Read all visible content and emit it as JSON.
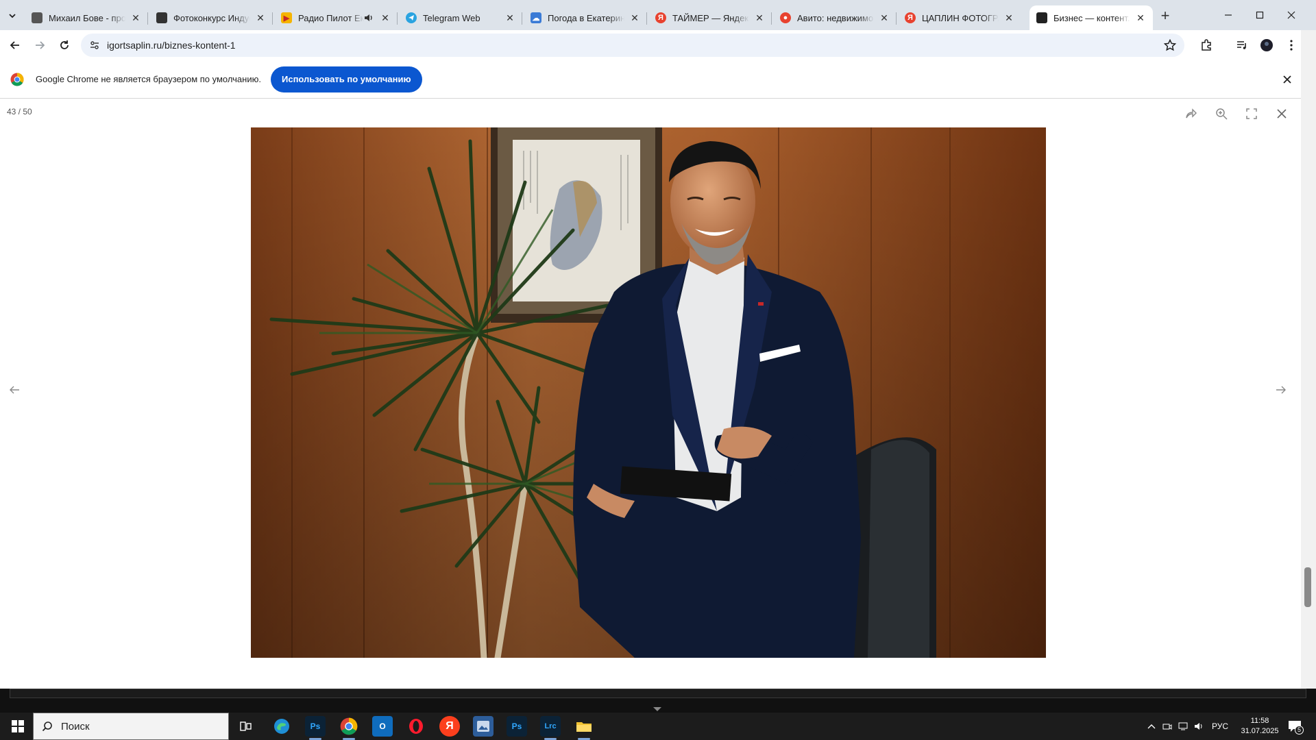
{
  "browser": {
    "tabs": [
      {
        "title": "Михаил Бове - проф",
        "favicon": "mb-icon",
        "color": "#444"
      },
      {
        "title": "Фотоконкурс Индус",
        "favicon": "photo-contest-icon",
        "color": "#333"
      },
      {
        "title": "Радио Пилот Ека",
        "favicon": "play-icon",
        "color": "#f5b400"
      },
      {
        "title": "Telegram Web",
        "favicon": "telegram-icon",
        "color": "#2aa3e0"
      },
      {
        "title": "Погода в Екатеринб",
        "favicon": "weather-icon",
        "color": "#3b7bd6"
      },
      {
        "title": "ТАЙМЕР — Яндекс",
        "favicon": "yandex-icon",
        "color": "#e8422f"
      },
      {
        "title": "Авито: недвижимос",
        "favicon": "avito-icon",
        "color": "#e8422f"
      },
      {
        "title": "ЦАПЛИН ФОТОГРАФ",
        "favicon": "yandex-icon",
        "color": "#e8422f"
      },
      {
        "title": "Бизнес — контент. Ф",
        "favicon": "site-icon",
        "color": "#222"
      }
    ],
    "url": "igortsaplin.ru/biznes-kontent-1"
  },
  "infobar": {
    "message": "Google Chrome не является браузером по умолчанию.",
    "button": "Использовать по умолчанию"
  },
  "lightbox": {
    "counter": "43 / 50"
  },
  "taskbar": {
    "search_placeholder": "Поиск",
    "lang": "РУС",
    "time": "11:58",
    "date": "31.07.2025",
    "notifications": "5",
    "apps": [
      {
        "name": "task-view",
        "label": ""
      },
      {
        "name": "edge",
        "label": "",
        "color": "#1f8fd6"
      },
      {
        "name": "photoshop-1",
        "label": "Ps",
        "color": "#0b2236"
      },
      {
        "name": "chrome",
        "label": "",
        "color": "#ffffff"
      },
      {
        "name": "outlook",
        "label": "O",
        "color": "#0f6cbd"
      },
      {
        "name": "opera",
        "label": "O",
        "color": "#ff1b2d"
      },
      {
        "name": "yandex-browser",
        "label": "Я",
        "color": "#fc3f1d"
      },
      {
        "name": "image-viewer",
        "label": "",
        "color": "#2d5d9a"
      },
      {
        "name": "photoshop-2",
        "label": "Ps",
        "color": "#0b2236"
      },
      {
        "name": "lightroom-classic",
        "label": "Lrc",
        "color": "#0b2236"
      },
      {
        "name": "file-explorer",
        "label": "",
        "color": "#f1c232"
      }
    ]
  }
}
